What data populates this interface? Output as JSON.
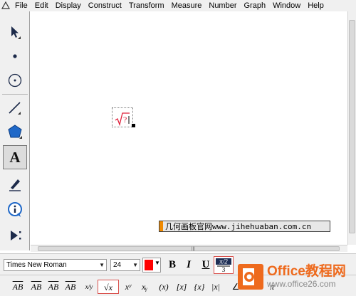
{
  "menu": {
    "items": [
      "File",
      "Edit",
      "Display",
      "Construct",
      "Transform",
      "Measure",
      "Number",
      "Graph",
      "Window",
      "Help"
    ]
  },
  "toolbox": {
    "tools": [
      "arrow-tool",
      "point-tool",
      "compass-tool",
      "straightedge-tool",
      "polygon-tool",
      "text-tool",
      "marker-tool",
      "information-tool",
      "custom-tool"
    ],
    "active": "text-tool",
    "text_tool_glyph": "A"
  },
  "canvas": {
    "text_object": "√?",
    "scrollbar_grip": "|||"
  },
  "watermark": {
    "text": "几何画板官网www.jihehuaban.com.cn"
  },
  "format_bar": {
    "font": "Times New Roman",
    "size": "24",
    "color": "#ff0000",
    "bold": "B",
    "italic": "I",
    "underline": "U"
  },
  "math_bar": {
    "symbols": [
      "AB",
      "AB",
      "AB",
      "AB",
      "x/y",
      "√x",
      "xʸ",
      "xᵧ",
      "(x)",
      "[x]",
      "{x}",
      "|x|",
      "∠",
      "π"
    ]
  },
  "logo": {
    "title": "Office教程网",
    "url": "www.office26.com"
  }
}
